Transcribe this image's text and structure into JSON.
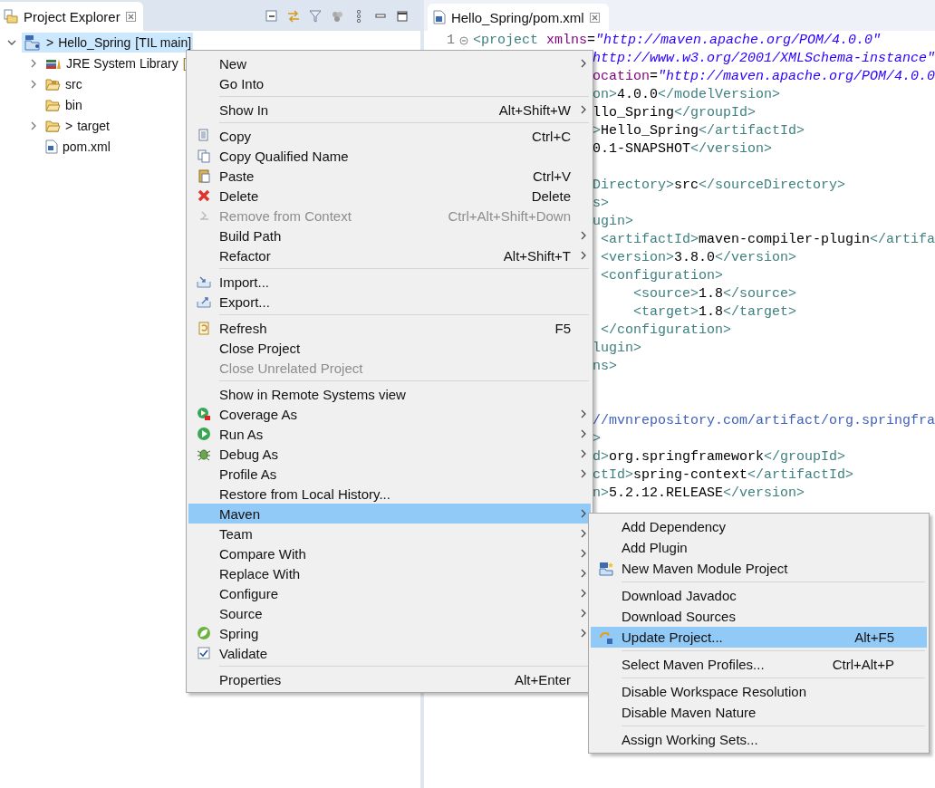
{
  "explorer": {
    "title": "Project Explorer",
    "tree": [
      {
        "prefix": ">",
        "label": "Hello_Spring",
        "decoration": "[TIL main]",
        "has_children": true,
        "expanded": true,
        "selected": true,
        "children": [
          {
            "label": "JRE System Library",
            "decoration": "[",
            "has_children": true,
            "expanded": false,
            "selected": false
          },
          {
            "label": "src",
            "has_children": true,
            "expanded": false,
            "selected": false
          },
          {
            "label": "bin",
            "has_children": false,
            "selected": false
          },
          {
            "prefix": ">",
            "label": "target",
            "has_children": true,
            "expanded": false,
            "selected": false
          },
          {
            "label": "pom.xml",
            "has_children": false,
            "selected": false
          }
        ]
      }
    ]
  },
  "editor": {
    "tab": "Hello_Spring/pom.xml",
    "line_number": "1",
    "first_line": [
      {
        "kind": "tag",
        "text": "<project"
      },
      {
        "kind": "attr",
        "text": " xmlns"
      },
      {
        "kind": "text",
        "text": "="
      },
      {
        "kind": "string",
        "text": "\"http://maven.apache.org/POM/4.0.0\""
      }
    ],
    "fragments": [
      {
        "kind": "code",
        "segments": [
          {
            "kind": "string",
            "text": "http://www.w3.org/2001/XMLSchema-instance\""
          }
        ]
      },
      {
        "kind": "code",
        "segments": [
          {
            "kind": "attr",
            "text": "ocation"
          },
          {
            "kind": "text",
            "text": "="
          },
          {
            "kind": "string",
            "text": "\"http://maven.apache.org/POM/4.0.0"
          }
        ]
      },
      {
        "kind": "code",
        "segments": [
          {
            "kind": "tag",
            "text": "on>"
          },
          {
            "kind": "text",
            "text": "4.0.0"
          },
          {
            "kind": "tag",
            "text": "</modelVersion>"
          }
        ]
      },
      {
        "kind": "code",
        "segments": [
          {
            "kind": "text",
            "text": "llo_Spring"
          },
          {
            "kind": "tag",
            "text": "</groupId>"
          }
        ]
      },
      {
        "kind": "code",
        "segments": [
          {
            "kind": "tag",
            "text": ">"
          },
          {
            "kind": "text",
            "text": "Hello_Spring"
          },
          {
            "kind": "tag",
            "text": "</artifactId>"
          }
        ]
      },
      {
        "kind": "code",
        "segments": [
          {
            "kind": "text",
            "text": "0.1-SNAPSHOT"
          },
          {
            "kind": "tag",
            "text": "</version>"
          }
        ]
      },
      {
        "kind": "blank"
      },
      {
        "kind": "code",
        "segments": [
          {
            "kind": "tag",
            "text": "Directory>"
          },
          {
            "kind": "text",
            "text": "src"
          },
          {
            "kind": "tag",
            "text": "</sourceDirectory>"
          }
        ]
      },
      {
        "kind": "code",
        "segments": [
          {
            "kind": "tag",
            "text": "s>"
          }
        ]
      },
      {
        "kind": "code",
        "segments": [
          {
            "kind": "tag",
            "text": "ugin>"
          }
        ]
      },
      {
        "kind": "code",
        "segments": [
          {
            "kind": "tag",
            "text": " <artifactId>"
          },
          {
            "kind": "text",
            "text": "maven-compiler-plugin"
          },
          {
            "kind": "tag",
            "text": "</artifa"
          }
        ]
      },
      {
        "kind": "code",
        "segments": [
          {
            "kind": "tag",
            "text": " <version>"
          },
          {
            "kind": "text",
            "text": "3.8.0"
          },
          {
            "kind": "tag",
            "text": "</version>"
          }
        ]
      },
      {
        "kind": "code",
        "segments": [
          {
            "kind": "tag",
            "text": " <configuration>"
          }
        ]
      },
      {
        "kind": "code",
        "segments": [
          {
            "kind": "tag",
            "text": "     <source>"
          },
          {
            "kind": "text",
            "text": "1.8"
          },
          {
            "kind": "tag",
            "text": "</source>"
          }
        ]
      },
      {
        "kind": "code",
        "segments": [
          {
            "kind": "tag",
            "text": "     <target>"
          },
          {
            "kind": "text",
            "text": "1.8"
          },
          {
            "kind": "tag",
            "text": "</target>"
          }
        ]
      },
      {
        "kind": "code",
        "segments": [
          {
            "kind": "tag",
            "text": " </configuration>"
          }
        ]
      },
      {
        "kind": "code",
        "segments": [
          {
            "kind": "tag",
            "text": "lugin>"
          }
        ]
      },
      {
        "kind": "code",
        "segments": [
          {
            "kind": "tag",
            "text": "ns>"
          }
        ]
      },
      {
        "kind": "blank"
      },
      {
        "kind": "blank"
      },
      {
        "kind": "code",
        "segments": [
          {
            "kind": "comment",
            "text": "//mvnrepository.com/artifact/org.springfra"
          }
        ]
      },
      {
        "kind": "code",
        "segments": [
          {
            "kind": "tag",
            "text": ">"
          }
        ]
      },
      {
        "kind": "code",
        "segments": [
          {
            "kind": "tag",
            "text": "d>"
          },
          {
            "kind": "text",
            "text": "org.springframework"
          },
          {
            "kind": "tag",
            "text": "</groupId>"
          }
        ]
      },
      {
        "kind": "code",
        "segments": [
          {
            "kind": "tag",
            "text": "ctId>"
          },
          {
            "kind": "text",
            "text": "spring-context"
          },
          {
            "kind": "tag",
            "text": "</artifactId>"
          }
        ]
      },
      {
        "kind": "code",
        "segments": [
          {
            "kind": "tag",
            "text": "n>"
          },
          {
            "kind": "text",
            "text": "5.2.12.RELEASE"
          },
          {
            "kind": "tag",
            "text": "</version>"
          }
        ]
      }
    ]
  },
  "context_menu": {
    "items": [
      {
        "kind": "item",
        "label": "New",
        "submenu": true,
        "disabled": false,
        "selected": false
      },
      {
        "kind": "item",
        "label": "Go Into",
        "submenu": false,
        "disabled": false,
        "selected": false
      },
      {
        "kind": "separator"
      },
      {
        "kind": "item",
        "label": "Show In",
        "shortcut": "Alt+Shift+W",
        "submenu": true,
        "disabled": false,
        "selected": false
      },
      {
        "kind": "separator"
      },
      {
        "kind": "item",
        "label": "Copy",
        "shortcut": "Ctrl+C",
        "submenu": false,
        "disabled": false,
        "selected": false
      },
      {
        "kind": "item",
        "label": "Copy Qualified Name",
        "submenu": false,
        "disabled": false,
        "selected": false
      },
      {
        "kind": "item",
        "label": "Paste",
        "shortcut": "Ctrl+V",
        "submenu": false,
        "disabled": false,
        "selected": false
      },
      {
        "kind": "item",
        "label": "Delete",
        "shortcut": "Delete",
        "submenu": false,
        "disabled": false,
        "selected": false
      },
      {
        "kind": "item",
        "label": "Remove from Context",
        "shortcut": "Ctrl+Alt+Shift+Down",
        "submenu": false,
        "disabled": true,
        "selected": false
      },
      {
        "kind": "item",
        "label": "Build Path",
        "submenu": true,
        "disabled": false,
        "selected": false
      },
      {
        "kind": "item",
        "label": "Refactor",
        "shortcut": "Alt+Shift+T",
        "submenu": true,
        "disabled": false,
        "selected": false
      },
      {
        "kind": "separator"
      },
      {
        "kind": "item",
        "label": "Import...",
        "submenu": false,
        "disabled": false,
        "selected": false
      },
      {
        "kind": "item",
        "label": "Export...",
        "submenu": false,
        "disabled": false,
        "selected": false
      },
      {
        "kind": "separator"
      },
      {
        "kind": "item",
        "label": "Refresh",
        "shortcut": "F5",
        "submenu": false,
        "disabled": false,
        "selected": false
      },
      {
        "kind": "item",
        "label": "Close Project",
        "submenu": false,
        "disabled": false,
        "selected": false
      },
      {
        "kind": "item",
        "label": "Close Unrelated Project",
        "submenu": false,
        "disabled": true,
        "selected": false
      },
      {
        "kind": "separator"
      },
      {
        "kind": "item",
        "label": "Show in Remote Systems view",
        "submenu": false,
        "disabled": false,
        "selected": false
      },
      {
        "kind": "item",
        "label": "Coverage As",
        "submenu": true,
        "disabled": false,
        "selected": false
      },
      {
        "kind": "item",
        "label": "Run As",
        "submenu": true,
        "disabled": false,
        "selected": false
      },
      {
        "kind": "item",
        "label": "Debug As",
        "submenu": true,
        "disabled": false,
        "selected": false
      },
      {
        "kind": "item",
        "label": "Profile As",
        "submenu": true,
        "disabled": false,
        "selected": false
      },
      {
        "kind": "item",
        "label": "Restore from Local History...",
        "submenu": false,
        "disabled": false,
        "selected": false
      },
      {
        "kind": "item",
        "label": "Maven",
        "submenu": true,
        "disabled": false,
        "selected": true
      },
      {
        "kind": "item",
        "label": "Team",
        "submenu": true,
        "disabled": false,
        "selected": false
      },
      {
        "kind": "item",
        "label": "Compare With",
        "submenu": true,
        "disabled": false,
        "selected": false
      },
      {
        "kind": "item",
        "label": "Replace With",
        "submenu": true,
        "disabled": false,
        "selected": false
      },
      {
        "kind": "item",
        "label": "Configure",
        "submenu": true,
        "disabled": false,
        "selected": false
      },
      {
        "kind": "item",
        "label": "Source",
        "submenu": true,
        "disabled": false,
        "selected": false
      },
      {
        "kind": "item",
        "label": "Spring",
        "submenu": true,
        "disabled": false,
        "selected": false
      },
      {
        "kind": "item",
        "label": "Validate",
        "submenu": false,
        "disabled": false,
        "selected": false
      },
      {
        "kind": "separator"
      },
      {
        "kind": "item",
        "label": "Properties",
        "shortcut": "Alt+Enter",
        "submenu": false,
        "disabled": false,
        "selected": false
      }
    ]
  },
  "maven_submenu": {
    "items": [
      {
        "kind": "item",
        "label": "Add Dependency",
        "selected": false
      },
      {
        "kind": "item",
        "label": "Add Plugin",
        "selected": false
      },
      {
        "kind": "item",
        "label": "New Maven Module Project",
        "selected": false
      },
      {
        "kind": "separator"
      },
      {
        "kind": "item",
        "label": "Download Javadoc",
        "selected": false
      },
      {
        "kind": "item",
        "label": "Download Sources",
        "selected": false
      },
      {
        "kind": "item",
        "label": "Update Project...",
        "shortcut": "Alt+F5",
        "selected": true
      },
      {
        "kind": "separator"
      },
      {
        "kind": "item",
        "label": "Select Maven Profiles...",
        "shortcut": "Ctrl+Alt+P",
        "selected": false
      },
      {
        "kind": "separator"
      },
      {
        "kind": "item",
        "label": "Disable Workspace Resolution",
        "selected": false
      },
      {
        "kind": "item",
        "label": "Disable Maven Nature",
        "selected": false
      },
      {
        "kind": "separator"
      },
      {
        "kind": "item",
        "label": "Assign Working Sets...",
        "selected": false
      }
    ]
  }
}
